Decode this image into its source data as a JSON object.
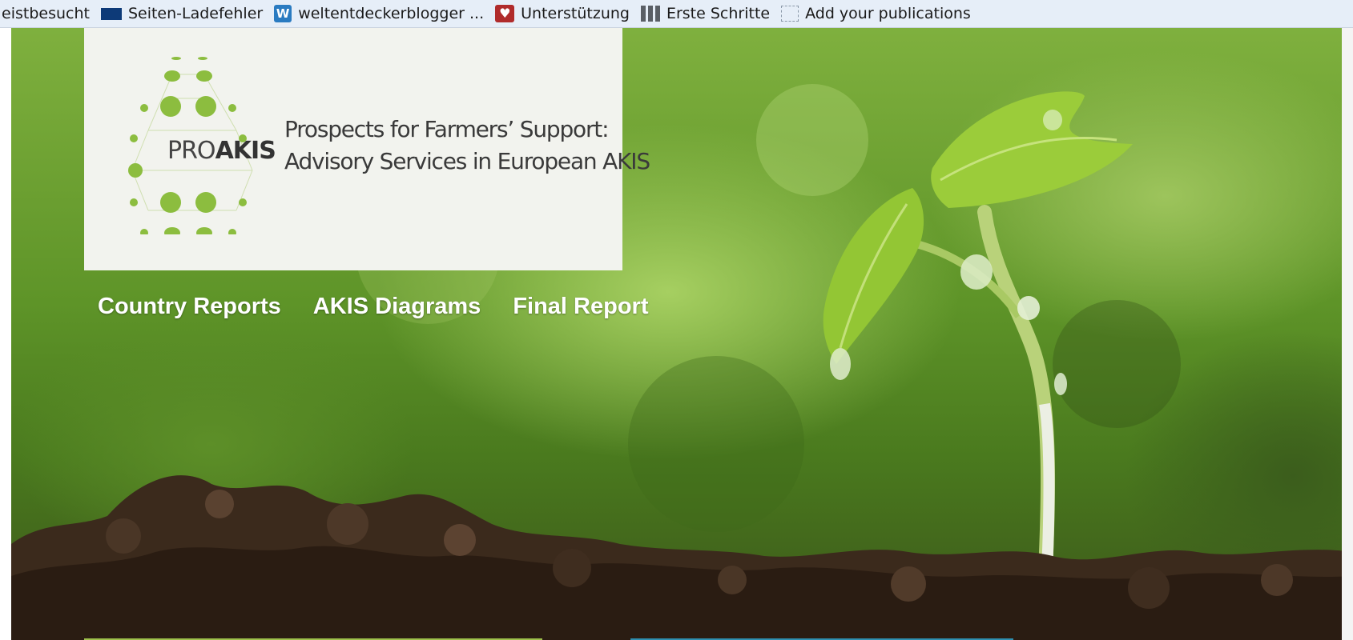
{
  "bookmarks": [
    {
      "label": "eistbesucht",
      "icon": "none"
    },
    {
      "label": "Seiten-Ladefehler",
      "icon": "flag-icon"
    },
    {
      "label": "weltentdeckerblogger ...",
      "icon": "wordpress-icon"
    },
    {
      "label": "Unterstützung",
      "icon": "support-heart-icon"
    },
    {
      "label": "Erste Schritte",
      "icon": "getting-started-icon"
    },
    {
      "label": "Add your publications",
      "icon": "dashed-box-icon"
    }
  ],
  "logo": {
    "pro": "PRO",
    "akis": "AKIS",
    "tagline_line1": "Prospects for Farmers’ Support:",
    "tagline_line2": "Advisory Services in European AKIS"
  },
  "nav": [
    {
      "label": "Country Reports"
    },
    {
      "label": "AKIS Diagrams"
    },
    {
      "label": "Final Report"
    }
  ],
  "colors": {
    "logo_green": "#8cbd3f",
    "nav_text": "#ffffff",
    "bookmark_bar": "#e6eef8"
  }
}
